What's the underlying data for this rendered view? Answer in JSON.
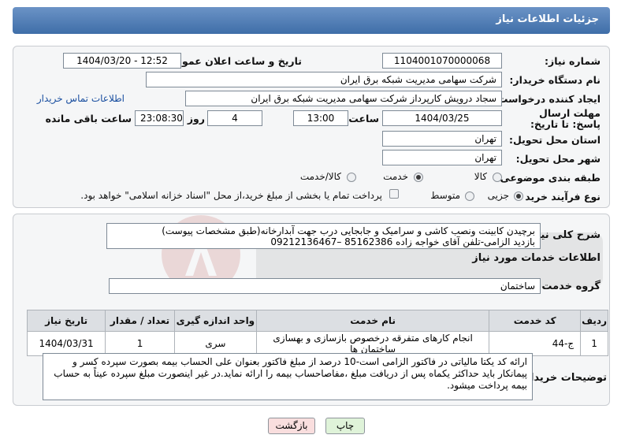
{
  "header": {
    "title": "جزئیات اطلاعات نیاز"
  },
  "labels": {
    "need_number": "شماره نیاز:",
    "announce_datetime": "تاریخ و ساعت اعلان عمومی:",
    "buyer_org": "نام دستگاه خریدار:",
    "requester": "ایجاد کننده درخواست:",
    "deadline": "مهلت ارسال پاسخ: تا تاریخ:",
    "hour": "ساعت",
    "day_and": "روز و",
    "hours_left": "ساعت باقی مانده",
    "province": "استان محل تحویل:",
    "city": "شهر محل تحویل:",
    "category": "طبقه بندی موضوعی:",
    "process_type": "نوع فرآیند خرید :",
    "description": "شرح کلی نیاز:",
    "services_info": "اطلاعات خدمات مورد نیاز",
    "service_group": "گروه خدمت:",
    "buyer_notes": "توضیحات خریدار:"
  },
  "values": {
    "need_number": "1104001070000068",
    "announce_datetime": "1404/03/20 - 12:52",
    "buyer_org": "شرکت سهامی مدیریت شبکه برق ایران",
    "requester": "سجاد درویش کارپرداز شرکت سهامی مدیریت شبکه برق ایران",
    "buyer_contact_link": "اطلاعات تماس خریدار",
    "deadline_date": "1404/03/25",
    "deadline_time": "13:00",
    "days_left": "4",
    "time_left": "23:08:30",
    "province": "تهران",
    "city": "تهران",
    "description_line1": "برچیدن کابینت ونصب کاشی و سرامیک و جابجایی درب جهت آبدارخانه(طبق مشخصات پیوست)",
    "description_line2": "بازدید الزامی-تلفن آقای خواجه زاده 85162386 –09212136467",
    "service_group": "ساختمان",
    "buyer_notes": "ارائه کد یکتا مالیاتی در فاکتور الزامی است-10 درصد از مبلغ فاکتور بعنوان علی الحساب بیمه بصورت سپرده کسر و پیمانکار باید حداکثر یکماه پس از دریافت مبلغ ،مفاصاحساب بیمه را ارائه نماید.در غیر اینصورت مبلغ سپرده عیناً به حساب بیمه پرداخت میشود."
  },
  "category_options": [
    {
      "label": "کالا",
      "selected": false
    },
    {
      "label": "خدمت",
      "selected": true
    },
    {
      "label": "کالا/خدمت",
      "selected": false
    }
  ],
  "process_options": [
    {
      "label": "جزیی",
      "selected": true
    },
    {
      "label": "متوسط",
      "selected": false
    }
  ],
  "payment_note": "پرداخت تمام یا بخشی از مبلغ خرید،از محل \"اسناد خزانه اسلامی\" خواهد بود.",
  "table": {
    "headers": [
      "ردیف",
      "کد خدمت",
      "نام خدمت",
      "واحد اندازه گیری",
      "تعداد / مقدار",
      "تاریخ نیاز"
    ],
    "rows": [
      [
        "1",
        "ج-44",
        "انجام کارهای متفرقه درخصوص بازسازی و بهسازی ساختمان ها",
        "سری",
        "1",
        "1404/03/31"
      ]
    ]
  },
  "buttons": {
    "print": "چاپ",
    "back": "بازگشت"
  },
  "colors": {
    "header": "#4f7cb5",
    "print_button": "#dff3d9",
    "back_button": "#f9dede",
    "link": "#1a4fa0"
  }
}
